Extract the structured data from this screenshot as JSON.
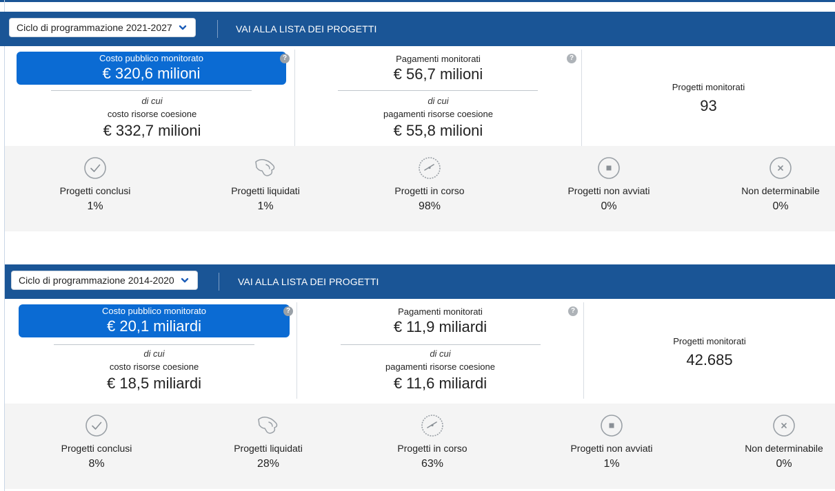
{
  "blocks": [
    {
      "cycle_select": "Ciclo di programmazione 2021-2027",
      "link_label": "VAI ALLA LISTA DEI PROGETTI",
      "costo_label": "Costo pubblico monitorato",
      "costo_value": "€ 320,6 milioni",
      "costo_di_cui": "di cui",
      "costo_sub_label": "costo risorse coesione",
      "costo_sub_value": "€ 332,7 milioni",
      "pagamenti_label": "Pagamenti monitorati",
      "pagamenti_value": "€ 56,7 milioni",
      "pagamenti_di_cui": "di cui",
      "pagamenti_sub_label": "pagamenti risorse coesione",
      "pagamenti_sub_value": "€ 55,8 milioni",
      "progetti_label": "Progetti monitorati",
      "progetti_value": "93",
      "help_glyph": "?",
      "stats": [
        {
          "label": "Progetti conclusi",
          "value": "1%",
          "icon": "check-circle-icon"
        },
        {
          "label": "Progetti liquidati",
          "value": "1%",
          "icon": "money-hand-icon"
        },
        {
          "label": "Progetti in corso",
          "value": "98%",
          "icon": "gauge-icon"
        },
        {
          "label": "Progetti non avviati",
          "value": "0%",
          "icon": "stop-circle-icon"
        },
        {
          "label": "Non determinabile",
          "value": "0%",
          "icon": "x-circle-icon"
        }
      ]
    },
    {
      "cycle_select": "Ciclo di programmazione 2014-2020",
      "link_label": "VAI ALLA LISTA DEI PROGETTI",
      "costo_label": "Costo pubblico monitorato",
      "costo_value": "€ 20,1 miliardi",
      "costo_di_cui": "di cui",
      "costo_sub_label": "costo risorse coesione",
      "costo_sub_value": "€ 18,5 miliardi",
      "pagamenti_label": "Pagamenti monitorati",
      "pagamenti_value": "€ 11,9 miliardi",
      "pagamenti_di_cui": "di cui",
      "pagamenti_sub_label": "pagamenti risorse coesione",
      "pagamenti_sub_value": "€ 11,6 miliardi",
      "progetti_label": "Progetti monitorati",
      "progetti_value": "42.685",
      "help_glyph": "?",
      "stats": [
        {
          "label": "Progetti conclusi",
          "value": "8%",
          "icon": "check-circle-icon"
        },
        {
          "label": "Progetti liquidati",
          "value": "28%",
          "icon": "money-hand-icon"
        },
        {
          "label": "Progetti in corso",
          "value": "63%",
          "icon": "gauge-icon"
        },
        {
          "label": "Progetti non avviati",
          "value": "1%",
          "icon": "stop-circle-icon"
        },
        {
          "label": "Non determinabile",
          "value": "0%",
          "icon": "x-circle-icon"
        }
      ]
    }
  ],
  "colors": {
    "header_blue": "#1a5596",
    "highlight_blue": "#0b6bd3",
    "stats_bg": "#f4f4f4"
  }
}
